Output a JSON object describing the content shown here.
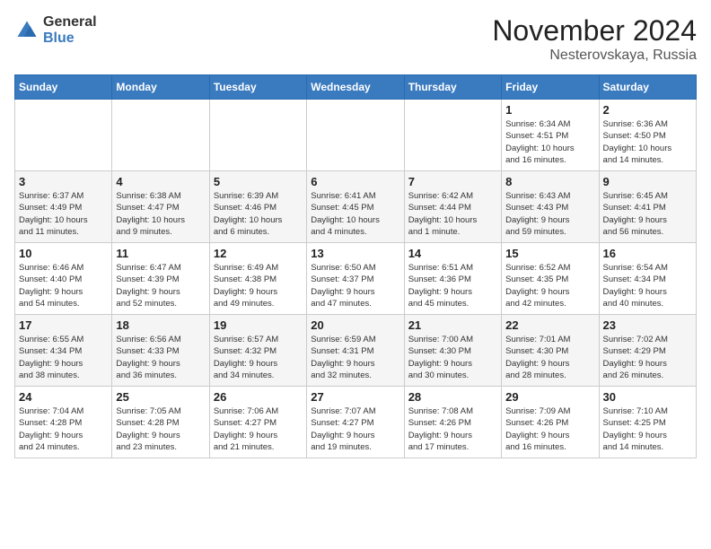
{
  "header": {
    "logo_general": "General",
    "logo_blue": "Blue",
    "month_title": "November 2024",
    "location": "Nesterovskaya, Russia"
  },
  "days_of_week": [
    "Sunday",
    "Monday",
    "Tuesday",
    "Wednesday",
    "Thursday",
    "Friday",
    "Saturday"
  ],
  "weeks": [
    [
      {
        "day": "",
        "info": ""
      },
      {
        "day": "",
        "info": ""
      },
      {
        "day": "",
        "info": ""
      },
      {
        "day": "",
        "info": ""
      },
      {
        "day": "",
        "info": ""
      },
      {
        "day": "1",
        "info": "Sunrise: 6:34 AM\nSunset: 4:51 PM\nDaylight: 10 hours\nand 16 minutes."
      },
      {
        "day": "2",
        "info": "Sunrise: 6:36 AM\nSunset: 4:50 PM\nDaylight: 10 hours\nand 14 minutes."
      }
    ],
    [
      {
        "day": "3",
        "info": "Sunrise: 6:37 AM\nSunset: 4:49 PM\nDaylight: 10 hours\nand 11 minutes."
      },
      {
        "day": "4",
        "info": "Sunrise: 6:38 AM\nSunset: 4:47 PM\nDaylight: 10 hours\nand 9 minutes."
      },
      {
        "day": "5",
        "info": "Sunrise: 6:39 AM\nSunset: 4:46 PM\nDaylight: 10 hours\nand 6 minutes."
      },
      {
        "day": "6",
        "info": "Sunrise: 6:41 AM\nSunset: 4:45 PM\nDaylight: 10 hours\nand 4 minutes."
      },
      {
        "day": "7",
        "info": "Sunrise: 6:42 AM\nSunset: 4:44 PM\nDaylight: 10 hours\nand 1 minute."
      },
      {
        "day": "8",
        "info": "Sunrise: 6:43 AM\nSunset: 4:43 PM\nDaylight: 9 hours\nand 59 minutes."
      },
      {
        "day": "9",
        "info": "Sunrise: 6:45 AM\nSunset: 4:41 PM\nDaylight: 9 hours\nand 56 minutes."
      }
    ],
    [
      {
        "day": "10",
        "info": "Sunrise: 6:46 AM\nSunset: 4:40 PM\nDaylight: 9 hours\nand 54 minutes."
      },
      {
        "day": "11",
        "info": "Sunrise: 6:47 AM\nSunset: 4:39 PM\nDaylight: 9 hours\nand 52 minutes."
      },
      {
        "day": "12",
        "info": "Sunrise: 6:49 AM\nSunset: 4:38 PM\nDaylight: 9 hours\nand 49 minutes."
      },
      {
        "day": "13",
        "info": "Sunrise: 6:50 AM\nSunset: 4:37 PM\nDaylight: 9 hours\nand 47 minutes."
      },
      {
        "day": "14",
        "info": "Sunrise: 6:51 AM\nSunset: 4:36 PM\nDaylight: 9 hours\nand 45 minutes."
      },
      {
        "day": "15",
        "info": "Sunrise: 6:52 AM\nSunset: 4:35 PM\nDaylight: 9 hours\nand 42 minutes."
      },
      {
        "day": "16",
        "info": "Sunrise: 6:54 AM\nSunset: 4:34 PM\nDaylight: 9 hours\nand 40 minutes."
      }
    ],
    [
      {
        "day": "17",
        "info": "Sunrise: 6:55 AM\nSunset: 4:34 PM\nDaylight: 9 hours\nand 38 minutes."
      },
      {
        "day": "18",
        "info": "Sunrise: 6:56 AM\nSunset: 4:33 PM\nDaylight: 9 hours\nand 36 minutes."
      },
      {
        "day": "19",
        "info": "Sunrise: 6:57 AM\nSunset: 4:32 PM\nDaylight: 9 hours\nand 34 minutes."
      },
      {
        "day": "20",
        "info": "Sunrise: 6:59 AM\nSunset: 4:31 PM\nDaylight: 9 hours\nand 32 minutes."
      },
      {
        "day": "21",
        "info": "Sunrise: 7:00 AM\nSunset: 4:30 PM\nDaylight: 9 hours\nand 30 minutes."
      },
      {
        "day": "22",
        "info": "Sunrise: 7:01 AM\nSunset: 4:30 PM\nDaylight: 9 hours\nand 28 minutes."
      },
      {
        "day": "23",
        "info": "Sunrise: 7:02 AM\nSunset: 4:29 PM\nDaylight: 9 hours\nand 26 minutes."
      }
    ],
    [
      {
        "day": "24",
        "info": "Sunrise: 7:04 AM\nSunset: 4:28 PM\nDaylight: 9 hours\nand 24 minutes."
      },
      {
        "day": "25",
        "info": "Sunrise: 7:05 AM\nSunset: 4:28 PM\nDaylight: 9 hours\nand 23 minutes."
      },
      {
        "day": "26",
        "info": "Sunrise: 7:06 AM\nSunset: 4:27 PM\nDaylight: 9 hours\nand 21 minutes."
      },
      {
        "day": "27",
        "info": "Sunrise: 7:07 AM\nSunset: 4:27 PM\nDaylight: 9 hours\nand 19 minutes."
      },
      {
        "day": "28",
        "info": "Sunrise: 7:08 AM\nSunset: 4:26 PM\nDaylight: 9 hours\nand 17 minutes."
      },
      {
        "day": "29",
        "info": "Sunrise: 7:09 AM\nSunset: 4:26 PM\nDaylight: 9 hours\nand 16 minutes."
      },
      {
        "day": "30",
        "info": "Sunrise: 7:10 AM\nSunset: 4:25 PM\nDaylight: 9 hours\nand 14 minutes."
      }
    ]
  ]
}
